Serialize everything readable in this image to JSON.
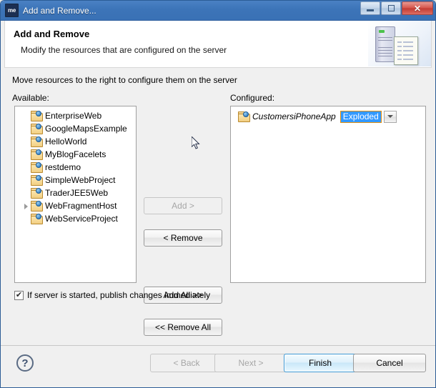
{
  "window": {
    "title": "Add and Remove...",
    "icon_label": "me",
    "controls": {
      "minimize": "minimize-button",
      "maximize": "maximize-button",
      "close": "✕"
    }
  },
  "header": {
    "title": "Add and Remove",
    "subtitle": "Modify the resources that are configured on the server"
  },
  "body": {
    "instruction": "Move resources to the right to configure them on the server",
    "available_label": "Available:",
    "configured_label": "Configured:"
  },
  "available": {
    "items": [
      {
        "label": "EnterpriseWeb",
        "expandable": false
      },
      {
        "label": "GoogleMapsExample",
        "expandable": false
      },
      {
        "label": "HelloWorld",
        "expandable": false
      },
      {
        "label": "MyBlogFacelets",
        "expandable": false
      },
      {
        "label": "restdemo",
        "expandable": false
      },
      {
        "label": "SimpleWebProject",
        "expandable": false
      },
      {
        "label": "TraderJEE5Web",
        "expandable": false
      },
      {
        "label": "WebFragmentHost",
        "expandable": true
      },
      {
        "label": "WebServiceProject",
        "expandable": false
      }
    ]
  },
  "configured": {
    "items": [
      {
        "label": "CustomersiPhoneApp",
        "deploy_mode": "Exploded"
      }
    ]
  },
  "transfer_buttons": {
    "add": "Add >",
    "remove": "< Remove",
    "add_all": "Add All >>",
    "remove_all": "<< Remove All"
  },
  "publish_option": {
    "label": "If server is started, publish changes immediately",
    "checked": true,
    "check_glyph": "✔"
  },
  "footer": {
    "help": "?",
    "back": "< Back",
    "next": "Next >",
    "finish": "Finish",
    "cancel": "Cancel"
  },
  "colors": {
    "titlebar": "#3c74b8",
    "selection": "#3399ff",
    "selection_border": "#e8900c",
    "default_button": "#3d9ad6"
  }
}
